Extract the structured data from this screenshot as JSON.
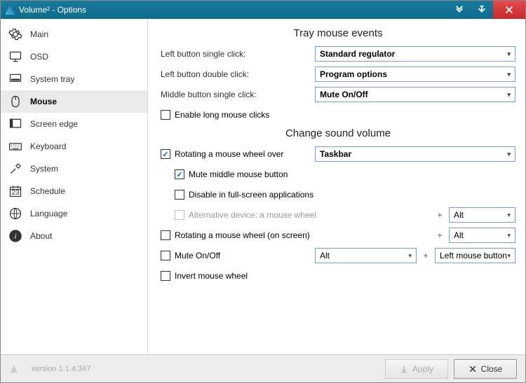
{
  "window": {
    "title": "Volume² - Options"
  },
  "sidebar": {
    "items": [
      {
        "label": "Main"
      },
      {
        "label": "OSD"
      },
      {
        "label": "System tray"
      },
      {
        "label": "Mouse"
      },
      {
        "label": "Screen edge"
      },
      {
        "label": "Keyboard"
      },
      {
        "label": "System"
      },
      {
        "label": "Schedule"
      },
      {
        "label": "Language"
      },
      {
        "label": "About"
      }
    ]
  },
  "section1": {
    "title": "Tray mouse events",
    "left_single_label": "Left button single click:",
    "left_single_value": "Standard regulator",
    "left_double_label": "Left button double click:",
    "left_double_value": "Program options",
    "middle_single_label": "Middle button single click:",
    "middle_single_value": "Mute On/Off",
    "enable_long_label": "Enable long mouse clicks"
  },
  "section2": {
    "title": "Change sound volume",
    "rotate_wheel_over_label": "Rotating a mouse wheel over",
    "rotate_wheel_over_value": "Taskbar",
    "mute_middle_label": "Mute middle mouse button",
    "disable_fullscreen_label": "Disable in full-screen applications",
    "alt_device_label": "Alternative device: a mouse wheel",
    "alt_device_mod": "Alt",
    "rotate_wheel_screen_label": "Rotating a mouse wheel (on screen)",
    "rotate_wheel_screen_mod": "Alt",
    "mute_onoff_label": "Mute On/Off",
    "mute_onoff_mod": "Alt",
    "mute_onoff_btn": "Left mouse button",
    "invert_label": "Invert mouse wheel"
  },
  "footer": {
    "version": "version 1.1.4.347",
    "apply": "Apply",
    "close": "Close"
  }
}
